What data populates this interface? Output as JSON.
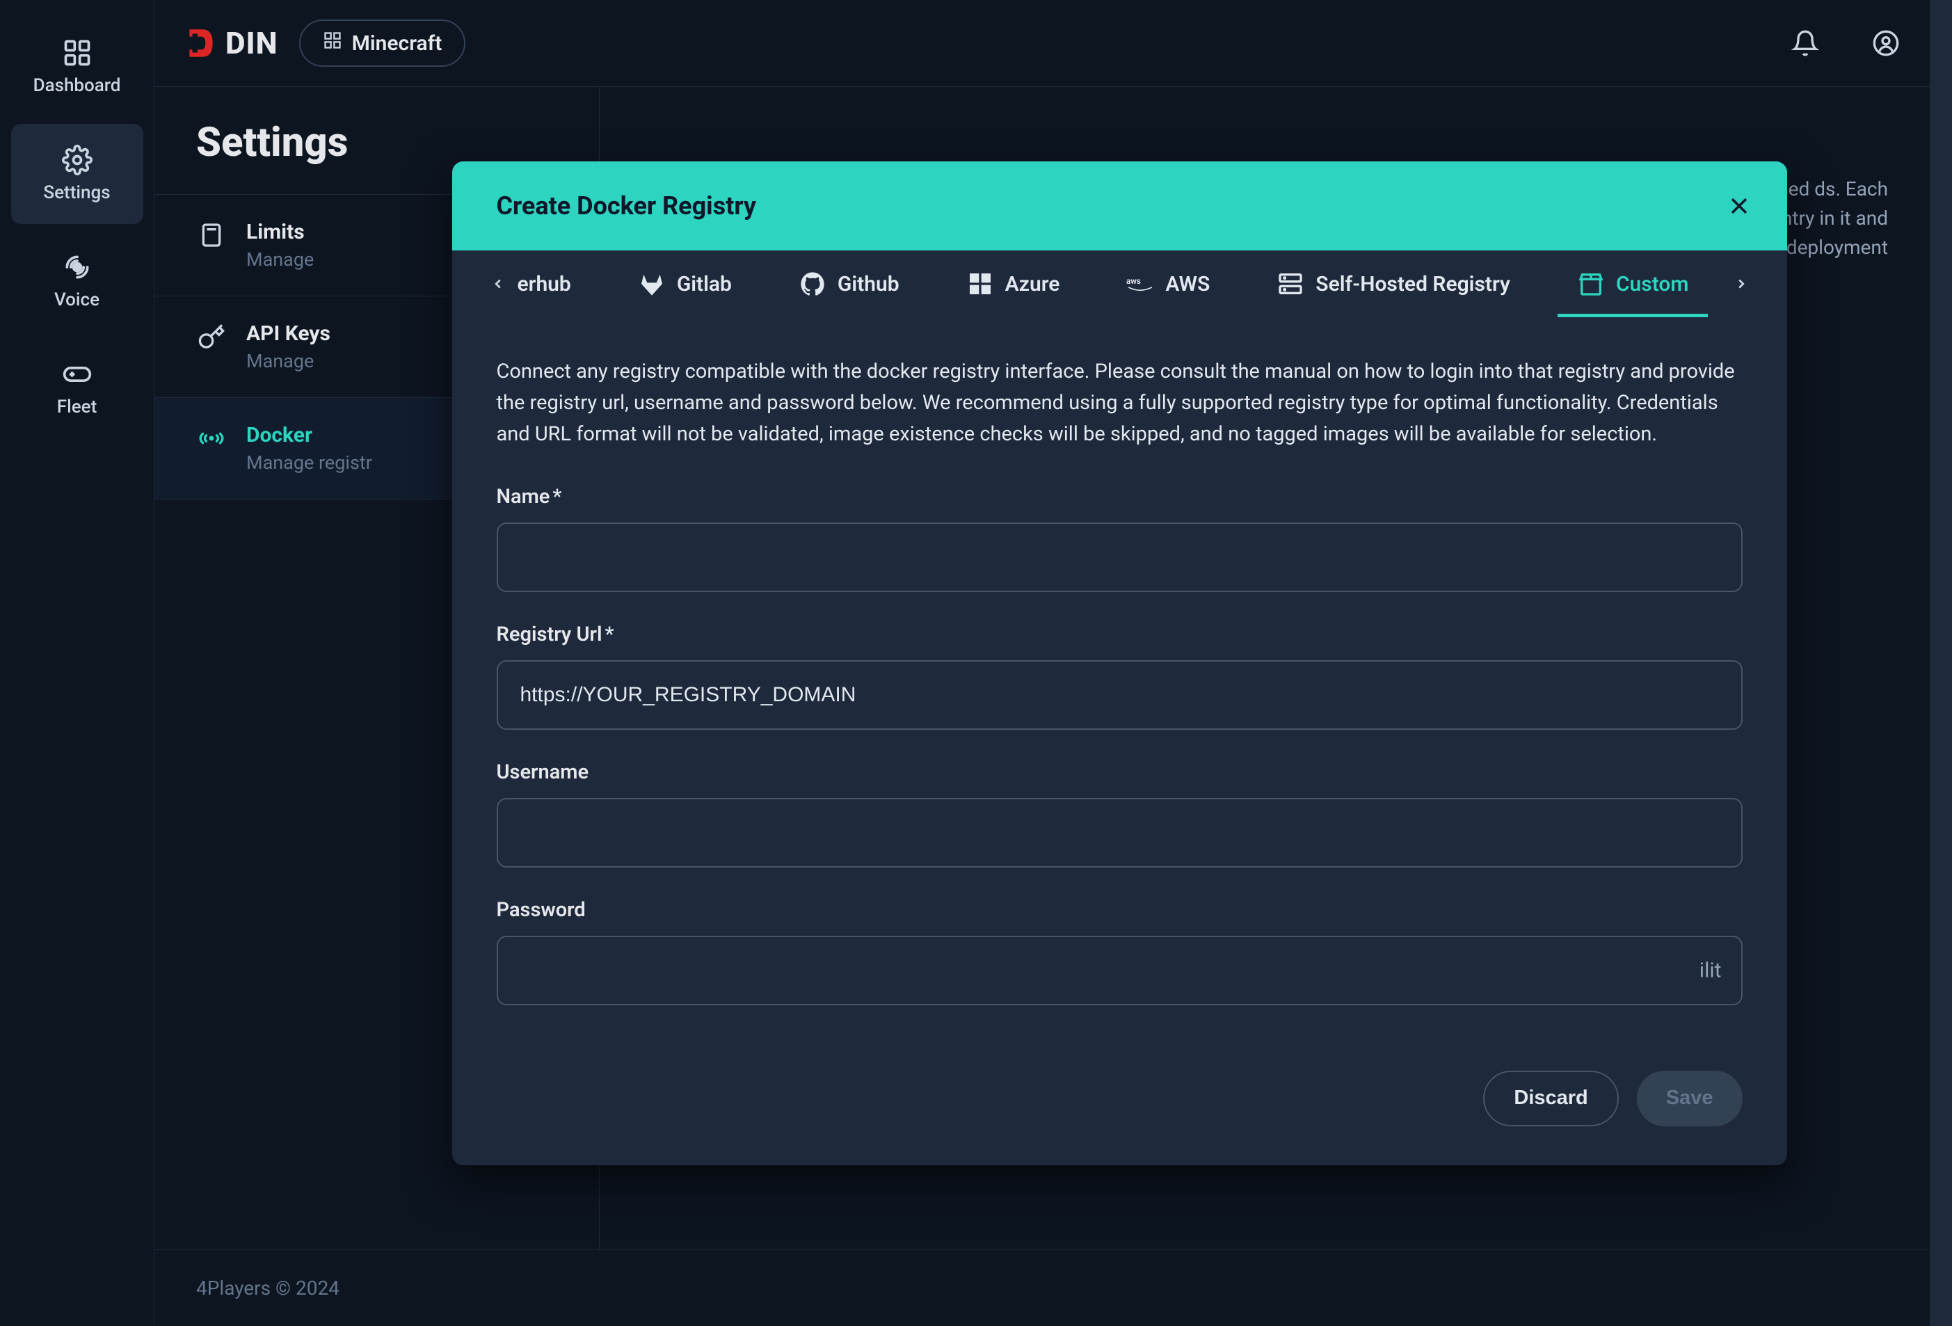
{
  "app": {
    "name": "DIN"
  },
  "header": {
    "context_label": "Minecraft"
  },
  "sidebar": {
    "items": [
      {
        "label": "Dashboard"
      },
      {
        "label": "Settings"
      },
      {
        "label": "Voice"
      },
      {
        "label": "Fleet"
      }
    ]
  },
  "page": {
    "title": "Settings",
    "sections": [
      {
        "name": "Limits",
        "desc": "Manage"
      },
      {
        "name": "API Keys",
        "desc": "Manage"
      },
      {
        "name": "Docker",
        "desc": "Manage registr"
      }
    ],
    "backdrop_text": "ther from widely-used ds. Each registry entry in it and deployment"
  },
  "modal": {
    "title": "Create Docker Registry",
    "tabs": [
      {
        "label": "erhub"
      },
      {
        "label": "Gitlab"
      },
      {
        "label": "Github"
      },
      {
        "label": "Azure"
      },
      {
        "label": "AWS"
      },
      {
        "label": "Self-Hosted Registry"
      },
      {
        "label": "Custom"
      }
    ],
    "description": "Connect any registry compatible with the docker registry interface. Please consult the manual on how to login into that registry and provide the registry url, username and password below. We recommend using a fully supported registry type for optimal functionality. Credentials and URL format will not be validated, image existence checks will be skipped, and no tagged images will be available for selection.",
    "fields": {
      "name": {
        "label": "Name",
        "required": true,
        "value": ""
      },
      "registry_url": {
        "label": "Registry Url",
        "required": true,
        "value": "https://YOUR_REGISTRY_DOMAIN"
      },
      "username": {
        "label": "Username",
        "required": false,
        "value": ""
      },
      "password": {
        "label": "Password",
        "required": false,
        "value": "",
        "suffix": "ilit"
      }
    },
    "buttons": {
      "discard": "Discard",
      "save": "Save"
    }
  },
  "footer": {
    "copyright": "4Players © 2024"
  }
}
